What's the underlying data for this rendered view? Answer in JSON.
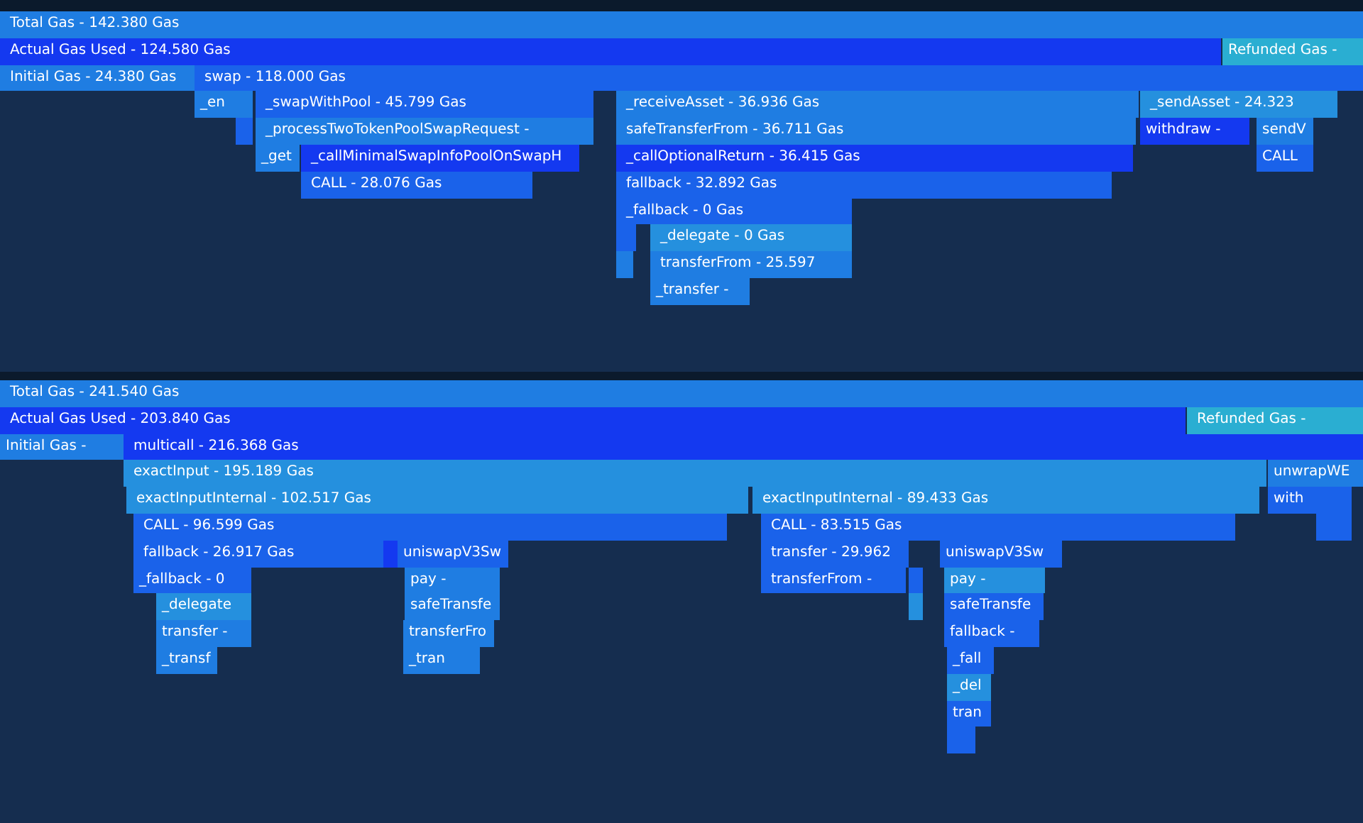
{
  "graphs": [
    {
      "rows": [
        {
          "frames": [
            {
              "label": "Total Gas - 142.380 Gas",
              "color": "#1f7de2"
            }
          ]
        },
        {
          "frames": [
            {
              "label": "Actual Gas Used - 124.580 Gas",
              "color": "#1439f0"
            },
            {
              "label": "Refunded Gas -",
              "color": "#2aaed2"
            }
          ]
        },
        {
          "frames": [
            {
              "label": "Initial Gas - 24.380 Gas",
              "color": "#1f7de2"
            },
            {
              "label": "swap - 118.000 Gas",
              "color": "#1a62ea"
            }
          ]
        },
        {
          "frames": [
            {
              "label": "_en",
              "color": "#1f7de2"
            },
            {
              "label": "_swapWithPool - 45.799 Gas",
              "color": "#1a62ea"
            },
            {
              "label": "_receiveAsset - 36.936 Gas",
              "color": "#1f7de2"
            },
            {
              "label": "_sendAsset - 24.323",
              "color": "#2590de"
            }
          ]
        },
        {
          "frames": [
            {
              "color": "#1a62ea"
            },
            {
              "label": "_processTwoTokenPoolSwapRequest -",
              "color": "#1f7de2"
            },
            {
              "label": "safeTransferFrom - 36.711 Gas",
              "color": "#1f7de2"
            },
            {
              "label": "withdraw -",
              "color": "#1439f0"
            },
            {
              "label": "sendV",
              "color": "#1f7de2"
            }
          ]
        },
        {
          "frames": [
            {
              "label": "_get",
              "color": "#1f7de2"
            },
            {
              "label": "_callMinimalSwapInfoPoolOnSwapH",
              "color": "#1439f0"
            },
            {
              "label": "_callOptionalReturn - 36.415 Gas",
              "color": "#1439f0"
            },
            {
              "label": "CALL",
              "color": "#1a62ea"
            }
          ]
        },
        {
          "frames": [
            {
              "label": "CALL - 28.076 Gas",
              "color": "#1a62ea"
            },
            {
              "label": "fallback - 32.892 Gas",
              "color": "#1a62ea"
            }
          ]
        },
        {
          "frames": [
            {
              "label": "_fallback - 0 Gas",
              "color": "#1a62ea"
            }
          ]
        },
        {
          "frames": [
            {
              "color": "#1a62ea"
            },
            {
              "label": "_delegate - 0 Gas",
              "color": "#2590de"
            }
          ]
        },
        {
          "frames": [
            {
              "color": "#1f7de2"
            },
            {
              "label": "transferFrom - 25.597",
              "color": "#1f7de2"
            }
          ]
        },
        {
          "frames": [
            {
              "label": "_transfer -",
              "color": "#1f7de2"
            }
          ]
        }
      ]
    },
    {
      "rows": [
        {
          "frames": [
            {
              "label": "Total Gas - 241.540 Gas",
              "color": "#1f7de2"
            }
          ]
        },
        {
          "frames": [
            {
              "label": "Actual Gas Used - 203.840 Gas",
              "color": "#1439f0"
            },
            {
              "label": "Refunded Gas -",
              "color": "#2aaed2"
            }
          ]
        },
        {
          "frames": [
            {
              "label": "Initial Gas -",
              "color": "#1f7de2"
            },
            {
              "label": "multicall - 216.368 Gas",
              "color": "#1439f0"
            }
          ]
        },
        {
          "frames": [
            {
              "label": "exactInput - 195.189 Gas",
              "color": "#2590de"
            },
            {
              "label": "unwrapWE",
              "color": "#1f7de2"
            }
          ]
        },
        {
          "frames": [
            {
              "label": "exactInputInternal - 102.517 Gas",
              "color": "#2590de"
            },
            {
              "label": "exactInputInternal - 89.433 Gas",
              "color": "#2590de"
            },
            {
              "label": "with",
              "color": "#1a62ea"
            },
            {
              "color": "#1a62ea"
            }
          ]
        },
        {
          "frames": [
            {
              "label": "CALL - 96.599 Gas",
              "color": "#1a62ea"
            },
            {
              "label": "CALL - 83.515 Gas",
              "color": "#1a62ea"
            },
            {
              "color": "#1a62ea"
            }
          ]
        },
        {
          "frames": [
            {
              "label": "fallback - 26.917 Gas",
              "color": "#1a62ea"
            },
            {
              "color": "#1439f0"
            },
            {
              "label": "uniswapV3Sw",
              "color": "#1a62ea"
            },
            {
              "label": "transfer - 29.962",
              "color": "#1a62ea"
            },
            {
              "label": "uniswapV3Sw",
              "color": "#1a62ea"
            }
          ]
        },
        {
          "frames": [
            {
              "label": "_fallback - 0",
              "color": "#1a62ea"
            },
            {
              "label": "pay -",
              "color": "#1f7de2"
            },
            {
              "label": "transferFrom -",
              "color": "#1a62ea"
            },
            {
              "color": "#1a62ea"
            },
            {
              "label": "pay -",
              "color": "#2590de"
            }
          ]
        },
        {
          "frames": [
            {
              "label": "_delegate",
              "color": "#2590de"
            },
            {
              "label": "safeTransfe",
              "color": "#1f7de2"
            },
            {
              "color": "#2590de"
            },
            {
              "label": "safeTransfe",
              "color": "#1a62ea"
            }
          ]
        },
        {
          "frames": [
            {
              "label": "transfer -",
              "color": "#1f7de2"
            },
            {
              "label": "transferFro",
              "color": "#1f7de2"
            },
            {
              "label": "fallback -",
              "color": "#1a62ea"
            }
          ]
        },
        {
          "frames": [
            {
              "label": "_transf",
              "color": "#1f7de2"
            },
            {
              "label": "_tran",
              "color": "#1f7de2"
            },
            {
              "label": "_fall",
              "color": "#1a62ea"
            }
          ]
        },
        {
          "frames": [
            {
              "label": "_del",
              "color": "#2590de"
            }
          ]
        },
        {
          "frames": [
            {
              "label": "tran",
              "color": "#1a62ea"
            }
          ]
        },
        {
          "frames": [
            {
              "color": "#1a62ea"
            }
          ]
        }
      ]
    }
  ]
}
